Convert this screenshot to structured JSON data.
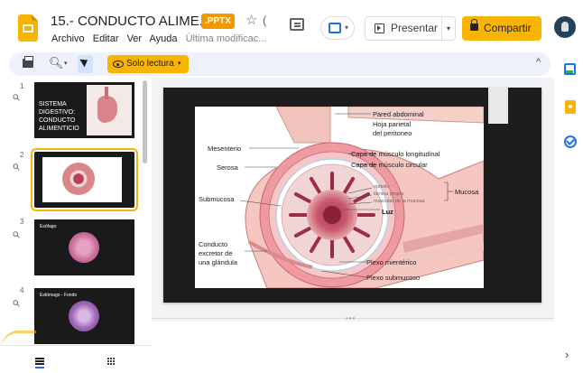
{
  "header": {
    "doc_title": "15.- CONDUCTO ALIME...",
    "format_badge": ".PPTX",
    "star_icon": "☆",
    "more_icon": "(",
    "menu": [
      "Archivo",
      "Editar",
      "Ver",
      "Ayuda"
    ],
    "last_edit": "Última modificac...",
    "present_label": "Presentar",
    "share_label": "Compartir",
    "accent_color": "#f8b400"
  },
  "toolbar": {
    "zoom_icon": "🔍︎",
    "readonly_label": "Solo lectura",
    "collapse_icon": "^"
  },
  "filmstrip": {
    "slides": [
      {
        "number": "1",
        "text_lines": [
          "SISTEMA",
          "DIGESTIVO:",
          "CONDUCTO",
          "ALIMENTICIO"
        ]
      },
      {
        "number": "2"
      },
      {
        "number": "3",
        "label": "Esófago"
      },
      {
        "number": "4",
        "label": "Estómago - Fondo"
      }
    ]
  },
  "slide": {
    "labels": {
      "pared": "Pared abdominal",
      "hoja1": "Hoja parietal",
      "hoja2": "del peritoneo",
      "mesenterio": "Mesenterio",
      "serosa": "Serosa",
      "long": "Capa de músculo longitudinal",
      "circ": "Capa de músculo circular",
      "submucosa": "Submucosa",
      "epitelio": "epitelio",
      "lamina": "lámina propia",
      "muscular": "muscular de la mucosa",
      "mucosa": "Mucosa",
      "luz": "Luz",
      "conducto1": "Conducto",
      "conducto2": "excretor de",
      "conducto3": "una glándula",
      "plexo_mient": "Plexo mientérico",
      "plexo_sub": "Plexo submucoso"
    }
  },
  "side_panel": {
    "expand_icon": "›"
  }
}
